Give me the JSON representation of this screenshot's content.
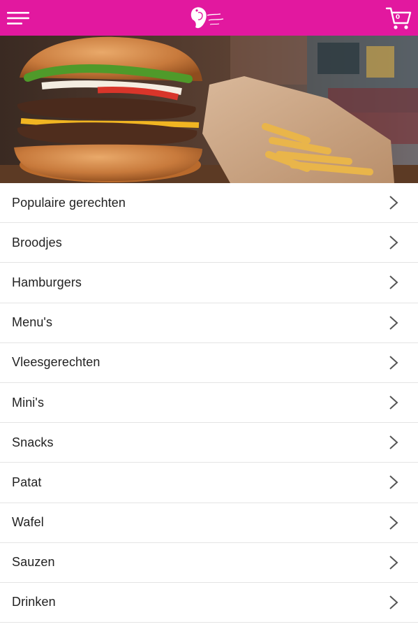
{
  "header": {
    "brand_color": "#e2189f",
    "menu_icon": "hamburger-menu-icon",
    "logo_icon": "restaurant-logo",
    "cart_icon": "shopping-cart-icon",
    "cart_count": "0"
  },
  "hero": {
    "image": "burger-and-fries-photo"
  },
  "categories": [
    {
      "label": "Populaire gerechten"
    },
    {
      "label": "Broodjes"
    },
    {
      "label": "Hamburgers"
    },
    {
      "label": "Menu's"
    },
    {
      "label": "Vleesgerechten"
    },
    {
      "label": "Mini's"
    },
    {
      "label": "Snacks"
    },
    {
      "label": "Patat"
    },
    {
      "label": "Wafel"
    },
    {
      "label": "Sauzen"
    },
    {
      "label": "Drinken"
    }
  ],
  "list_icon": "chevron-right-icon"
}
